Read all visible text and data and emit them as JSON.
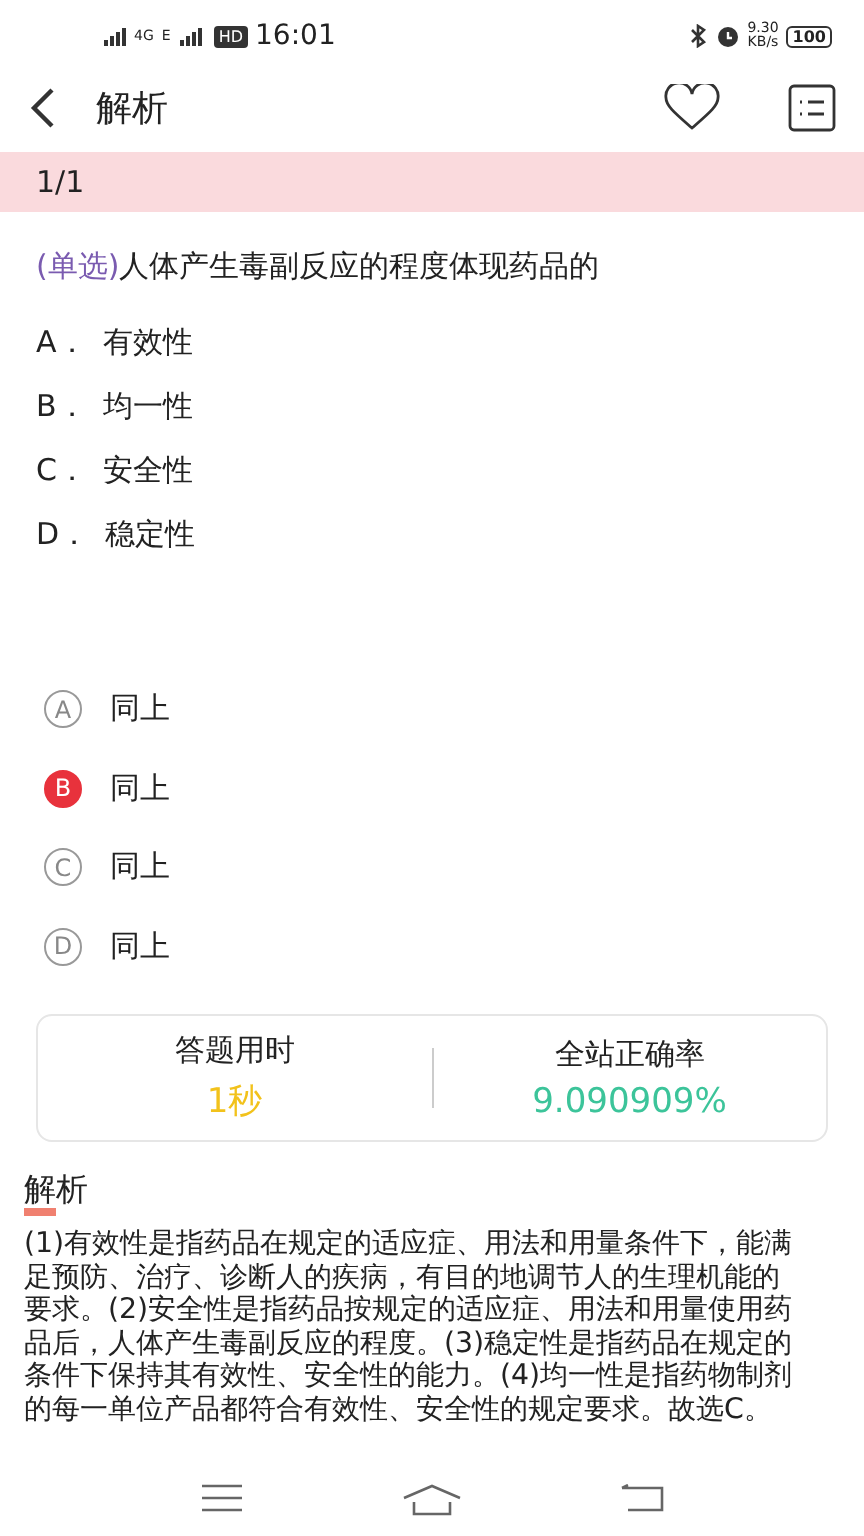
{
  "status_bar": {
    "network": "4G",
    "network2": "E",
    "hd": "HD",
    "time": "16:01",
    "speed": "9.30",
    "speed_unit": "KB/s",
    "battery": "100"
  },
  "header": {
    "title": "解析"
  },
  "progress": "1/1",
  "question": {
    "type_label": "(单选)",
    "text": "人体产生毒副反应的程度体现药品的",
    "options": [
      {
        "letter": "A．",
        "text": "有效性"
      },
      {
        "letter": "B．",
        "text": "均一性"
      },
      {
        "letter": "C．",
        "text": "安全性"
      },
      {
        "letter": "D．",
        "text": "稳定性"
      }
    ]
  },
  "answers": [
    {
      "letter": "A",
      "text": "同上",
      "selected": false
    },
    {
      "letter": "B",
      "text": "同上",
      "selected": true
    },
    {
      "letter": "C",
      "text": "同上",
      "selected": false
    },
    {
      "letter": "D",
      "text": "同上",
      "selected": false
    }
  ],
  "stats": [
    {
      "label": "答题用时",
      "value": "1秒",
      "color": "#f2c21b"
    },
    {
      "label": "全站正确率",
      "value": "9.090909%",
      "color": "#3cc49a"
    }
  ],
  "analysis": {
    "title": "解析",
    "text": "(1)有效性是指药品在规定的适应症、用法和用量条件下，能满足预防、治疗、诊断人的疾病，有目的地调节人的生理机能的要求。(2)安全性是指药品按规定的适应症、用法和用量使用药品后，人体产生毒副反应的程度。(3)稳定性是指药品在规定的条件下保持其有效性、安全性的能力。(4)均一性是指药物制剂的每一单位产品都符合有效性、安全性的规定要求。故选C。"
  }
}
